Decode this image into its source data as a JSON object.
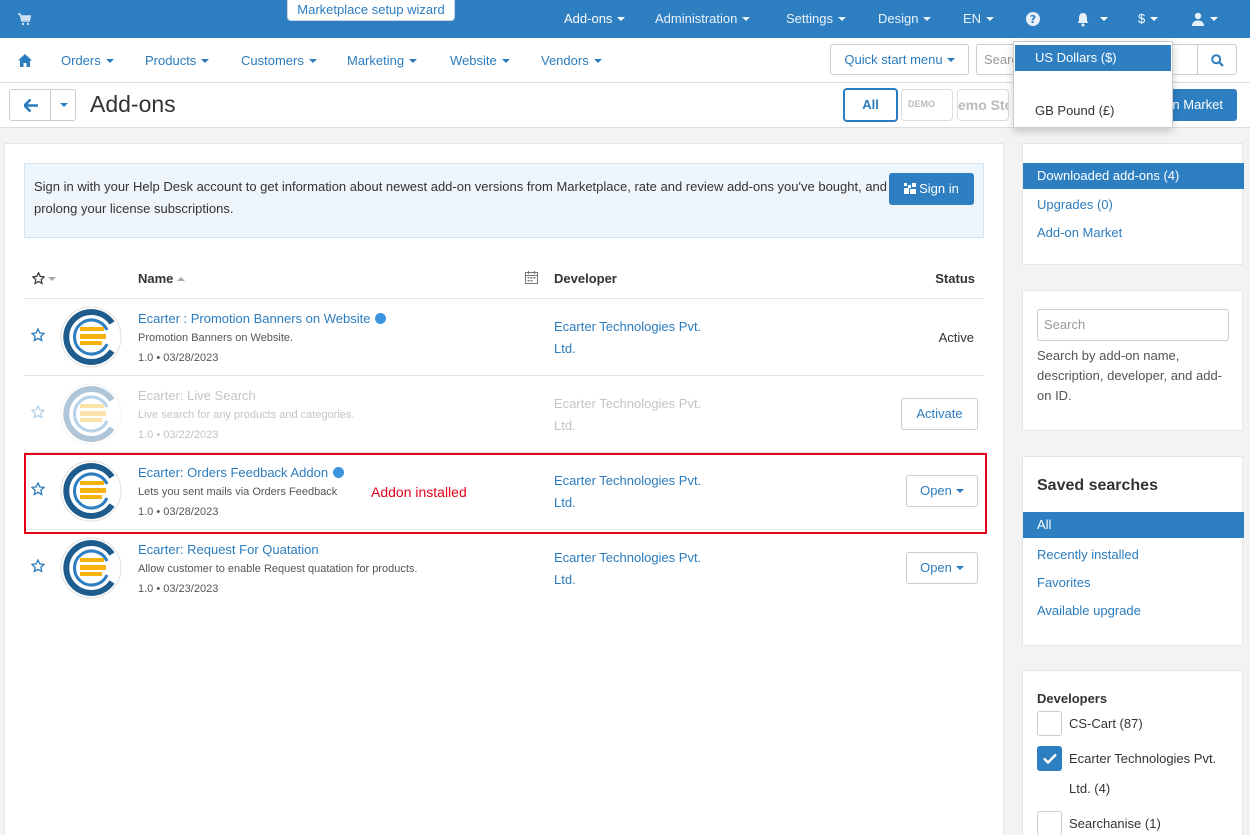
{
  "topbar": {
    "wizard": "Marketplace setup wizard",
    "menu": [
      "Add-ons",
      "Administration",
      "Settings",
      "Design",
      "EN",
      "$"
    ],
    "icons": [
      "cart-icon",
      "help-icon",
      "bell-icon",
      "user-icon"
    ]
  },
  "nav": {
    "items": [
      "Orders",
      "Products",
      "Customers",
      "Marketing",
      "Website",
      "Vendors"
    ],
    "quick_start": "Quick start menu",
    "search_placeholder": "Search"
  },
  "title_bar": {
    "title": "Add-ons",
    "filter_all": "All",
    "filter_demo": "DEMO",
    "filter_demo_store": "emo Sto",
    "market_button": "n Market"
  },
  "currency_dropdown": {
    "selected": "US Dollars ($)",
    "option": "GB Pound (£)"
  },
  "info": {
    "text": "Sign in with your Help Desk account to get information about newest add-on versions from Marketplace, rate and review add-ons you've bought, and prolong your license subscriptions.",
    "sign_in": "Sign in"
  },
  "table": {
    "headers": {
      "name": "Name",
      "developer": "Developer",
      "status": "Status"
    },
    "rows": [
      {
        "name": "Ecarter : Promotion Banners on Website",
        "desc": "Promotion Banners on Website.",
        "version": "1.0 • 03/28/2023",
        "developer": "Ecarter Technologies Pvt. Ltd.",
        "status": "Active"
      },
      {
        "name": "Ecarter: Live Search",
        "desc": "Live search for any products and categories.",
        "version": "1.0 • 03/22/2023",
        "developer": "Ecarter Technologies Pvt. Ltd.",
        "action": "Activate"
      },
      {
        "name": "Ecarter: Orders Feedback Addon",
        "desc": "Lets you sent mails via Orders Feedback",
        "version": "1.0 • 03/28/2023",
        "developer": "Ecarter Technologies Pvt. Ltd.",
        "action": "Open"
      },
      {
        "name": "Ecarter: Request For Quatation",
        "desc": "Allow customer to enable Request quatation for products.",
        "version": "1.0 • 03/23/2023",
        "developer": "Ecarter Technologies Pvt. Ltd.",
        "action": "Open"
      }
    ]
  },
  "annotation": "Addon installed",
  "sidebar": {
    "views": [
      "Downloaded add-ons (4)",
      "Upgrades (0)",
      "Add-on Market"
    ],
    "search_placeholder": "Search",
    "search_help": "Search by add-on name, description, developer, and add-on ID.",
    "saved_title": "Saved searches",
    "saved": [
      "All",
      "Recently installed",
      "Favorites",
      "Available upgrade"
    ],
    "developers_title": "Developers",
    "developers": [
      {
        "label": "CS-Cart (87)",
        "checked": false
      },
      {
        "label": "Ecarter Technologies Pvt. Ltd. (4)",
        "checked": true
      },
      {
        "label": "Searchanise (1)",
        "checked": false
      }
    ]
  },
  "colors": {
    "primary": "#2d7fc2",
    "link": "#2b7cbe",
    "annotation": "#e3001b"
  }
}
